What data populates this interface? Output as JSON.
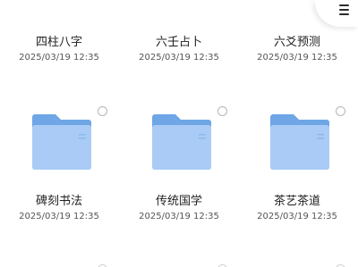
{
  "colors": {
    "folder_back": "#6ea6e6",
    "folder_front": "#a9cbf5",
    "text_primary": "#1f1f1f",
    "text_secondary": "#555555"
  },
  "header": {
    "menu_icon": "hamburger-menu-icon"
  },
  "folders": [
    {
      "name": "四柱八字",
      "date": "2025/03/19 12:35"
    },
    {
      "name": "六壬占卜",
      "date": "2025/03/19 12:35"
    },
    {
      "name": "六爻预测",
      "date": "2025/03/19 12:35"
    },
    {
      "name": "碑刻书法",
      "date": "2025/03/19 12:35"
    },
    {
      "name": "传统国学",
      "date": "2025/03/19 12:35"
    },
    {
      "name": "茶艺茶道",
      "date": "2025/03/19 12:35"
    }
  ]
}
